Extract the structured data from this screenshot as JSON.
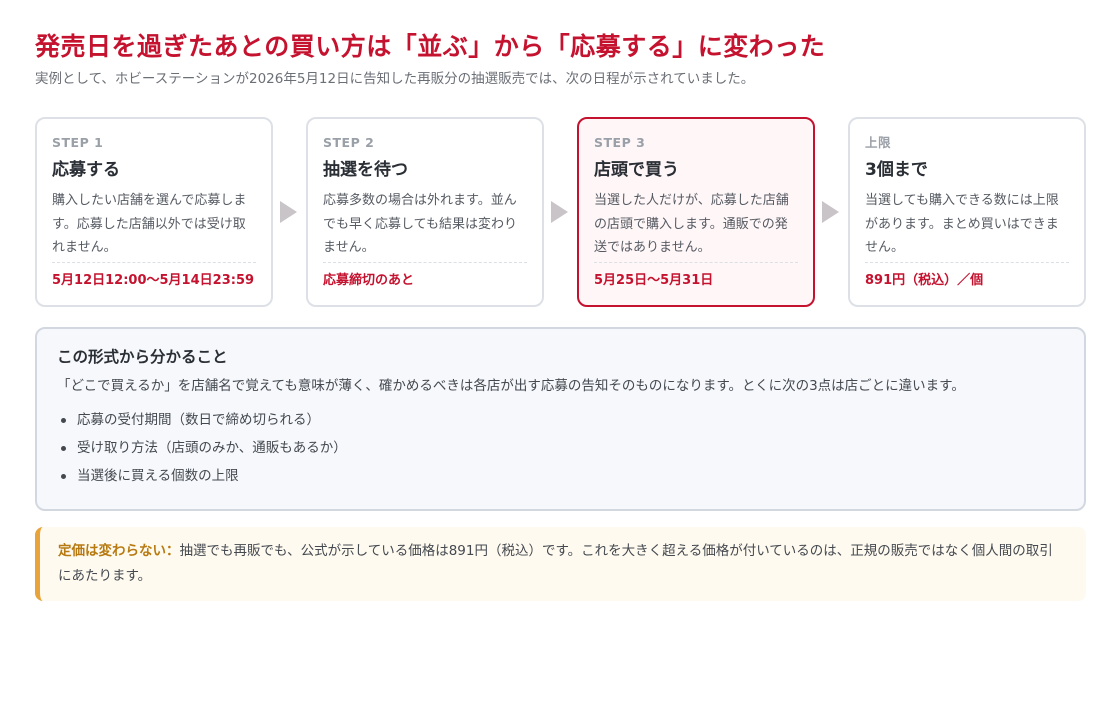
{
  "header": {
    "title": "発売日を過ぎたあとの買い方は「並ぶ」から「応募する」に変わった",
    "subtitle": "実例として、ホビーステーションが2026年5月12日に告知した再販分の抽選販売では、次の日程が示されていました。"
  },
  "steps": [
    {
      "label": "STEP 1",
      "title": "応募する",
      "desc": "購入したい店舗を選んで応募します。応募した店舗以外では受け取れません。",
      "note": "5月12日12:00〜5月14日23:59"
    },
    {
      "label": "STEP 2",
      "title": "抽選を待つ",
      "desc": "応募多数の場合は外れます。並んでも早く応募しても結果は変わりません。",
      "note": "応募締切のあと"
    },
    {
      "label": "STEP 3",
      "title": "店頭で買う",
      "desc": "当選した人だけが、応募した店舗の店頭で購入します。通販での発送ではありません。",
      "note": "5月25日〜5月31日"
    },
    {
      "label": "上限",
      "title": "3個まで",
      "desc": "当選しても購入できる数には上限があります。まとめ買いはできません。",
      "note": "891円（税込）／個"
    }
  ],
  "info": {
    "title": "この形式から分かること",
    "text": "「どこで買えるか」を店舗名で覚えても意味が薄く、確かめるべきは各店が出す応募の告知そのものになります。とくに次の3点は店ごとに違います。",
    "items": [
      "応募の受付期間（数日で締め切られる）",
      "受け取り方法（店頭のみか、通販もあるか）",
      "当選後に買える個数の上限"
    ]
  },
  "notice": {
    "lead": "定価は変わらない：",
    "text": "抽選でも再販でも、公式が示している価格は891円（税込）です。これを大きく超える価格が付いているのは、正規の販売ではなく個人間の取引にあたります。"
  },
  "colors": {
    "accent": "#c4122f",
    "highlight_bg": "#fff6f7",
    "notice_border": "#e8a33a",
    "notice_lead": "#b77a12"
  }
}
